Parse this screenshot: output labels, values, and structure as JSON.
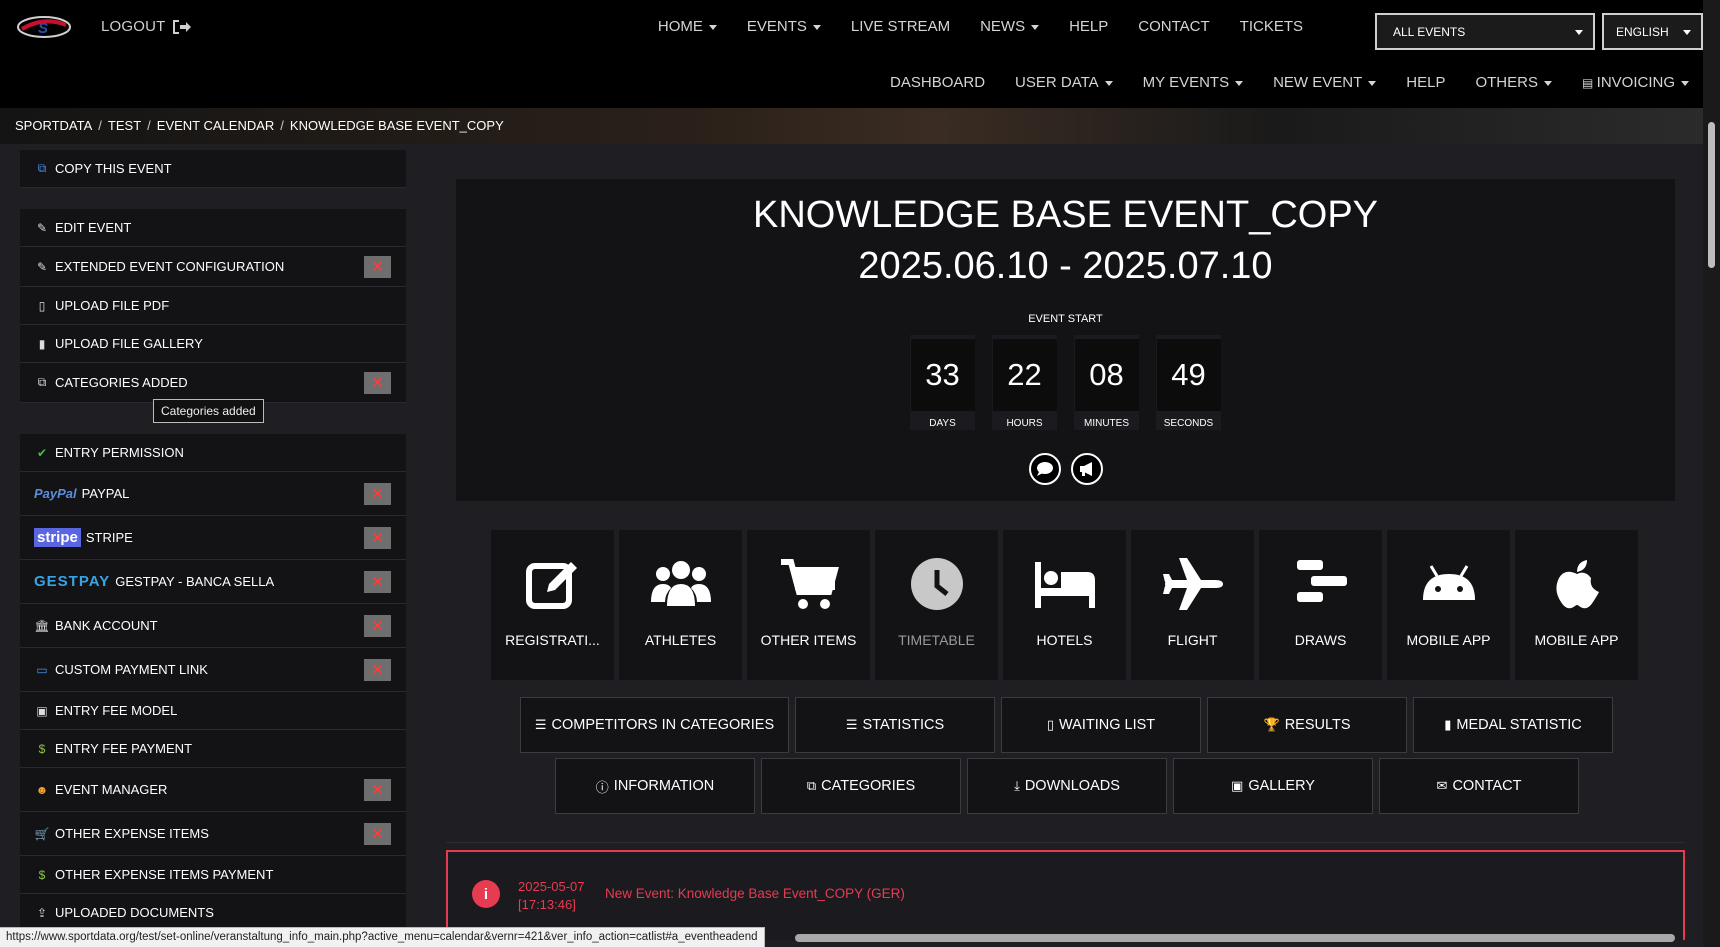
{
  "topnav": {
    "logout": "LOGOUT",
    "items": [
      "HOME",
      "EVENTS",
      "LIVE STREAM",
      "NEWS",
      "HELP",
      "CONTACT",
      "TICKETS"
    ],
    "events_select": "ALL EVENTS",
    "lang_select": "ENGLISH"
  },
  "subnav": {
    "items": [
      "DASHBOARD",
      "USER DATA",
      "MY EVENTS",
      "NEW EVENT",
      "HELP",
      "OTHERS",
      "INVOICING"
    ]
  },
  "breadcrumb": [
    "SPORTDATA",
    "TEST",
    "EVENT CALENDAR",
    "KNOWLEDGE BASE EVENT_COPY"
  ],
  "sidebar": {
    "items": [
      {
        "label": "COPY THIS EVENT",
        "icon": "copy-icon"
      },
      {
        "label": "EDIT EVENT",
        "icon": "edit-file-icon"
      },
      {
        "label": "EXTENDED EVENT CONFIGURATION",
        "icon": "edit-file-icon"
      },
      {
        "label": "UPLOAD FILE PDF",
        "icon": "pdf-file-icon"
      },
      {
        "label": "UPLOAD FILE GALLERY",
        "icon": "image-file-icon"
      },
      {
        "label": "CATEGORIES ADDED",
        "icon": "copy-icon"
      },
      {
        "label": "ENTRY PERMISSION",
        "icon": "check-icon"
      },
      {
        "label": "PAYPAL",
        "icon": "paypal-logo",
        "logo": "PayPal"
      },
      {
        "label": "STRIPE",
        "icon": "stripe-logo",
        "logo": "stripe"
      },
      {
        "label": "GESTPAY - BANCA SELLA",
        "icon": "gestpay-logo",
        "logo": "GESTPAY"
      },
      {
        "label": "BANK ACCOUNT",
        "icon": "bank-icon"
      },
      {
        "label": "CUSTOM PAYMENT LINK",
        "icon": "card-icon"
      },
      {
        "label": "ENTRY FEE MODEL",
        "icon": "money-icon"
      },
      {
        "label": "ENTRY FEE PAYMENT",
        "icon": "money-bag-icon"
      },
      {
        "label": "EVENT MANAGER",
        "icon": "user-icon"
      },
      {
        "label": "OTHER EXPENSE ITEMS",
        "icon": "cart-icon"
      },
      {
        "label": "OTHER EXPENSE ITEMS PAYMENT",
        "icon": "money-bag-icon"
      },
      {
        "label": "UPLOADED DOCUMENTS",
        "icon": "upload-icon"
      }
    ],
    "tooltip": "Categories added"
  },
  "hero": {
    "title": "KNOWLEDGE BASE EVENT_COPY",
    "dates": "2025.06.10 - 2025.07.10",
    "start_label": "EVENT START",
    "countdown": [
      {
        "value": "33",
        "label": "DAYS"
      },
      {
        "value": "22",
        "label": "HOURS"
      },
      {
        "value": "08",
        "label": "MINUTES"
      },
      {
        "value": "49",
        "label": "SECONDS"
      }
    ]
  },
  "tiles": [
    {
      "label": "REGISTRATI...",
      "icon": "edit-icon"
    },
    {
      "label": "ATHLETES",
      "icon": "users-icon"
    },
    {
      "label": "OTHER ITEMS",
      "icon": "cart-icon"
    },
    {
      "label": "TIMETABLE",
      "icon": "clock-icon"
    },
    {
      "label": "HOTELS",
      "icon": "bed-icon"
    },
    {
      "label": "FLIGHT",
      "icon": "plane-icon"
    },
    {
      "label": "DRAWS",
      "icon": "bracket-icon"
    },
    {
      "label": "MOBILE APP",
      "icon": "android-icon"
    },
    {
      "label": "MOBILE APP",
      "icon": "apple-icon"
    }
  ],
  "buttons_row1": [
    {
      "label": "COMPETITORS IN CATEGORIES",
      "icon": "list-check-icon"
    },
    {
      "label": "STATISTICS",
      "icon": "list-icon"
    },
    {
      "label": "WAITING LIST",
      "icon": "question-file-icon"
    },
    {
      "label": "RESULTS",
      "icon": "trophy-icon"
    },
    {
      "label": "MEDAL STATISTIC",
      "icon": "bar-chart-icon"
    }
  ],
  "buttons_row2": [
    {
      "label": "INFORMATION",
      "icon": "info-icon"
    },
    {
      "label": "CATEGORIES",
      "icon": "copy-icon"
    },
    {
      "label": "DOWNLOADS",
      "icon": "download-icon"
    },
    {
      "label": "GALLERY",
      "icon": "image-icon"
    },
    {
      "label": "CONTACT",
      "icon": "envelope-icon"
    }
  ],
  "notice": {
    "date": "2025-05-07",
    "time": "[17:13:46]",
    "text": "New Event: Knowledge Base Event_COPY (GER)"
  },
  "status_url": "https://www.sportdata.org/test/set-online/veranstaltung_info_main.php?active_menu=calendar&vernr=421&ver_info_action=catlist#a_eventheadend",
  "colors": {
    "accent_red": "#e63b50",
    "panel": "#131316",
    "background": "#1f1f23"
  }
}
